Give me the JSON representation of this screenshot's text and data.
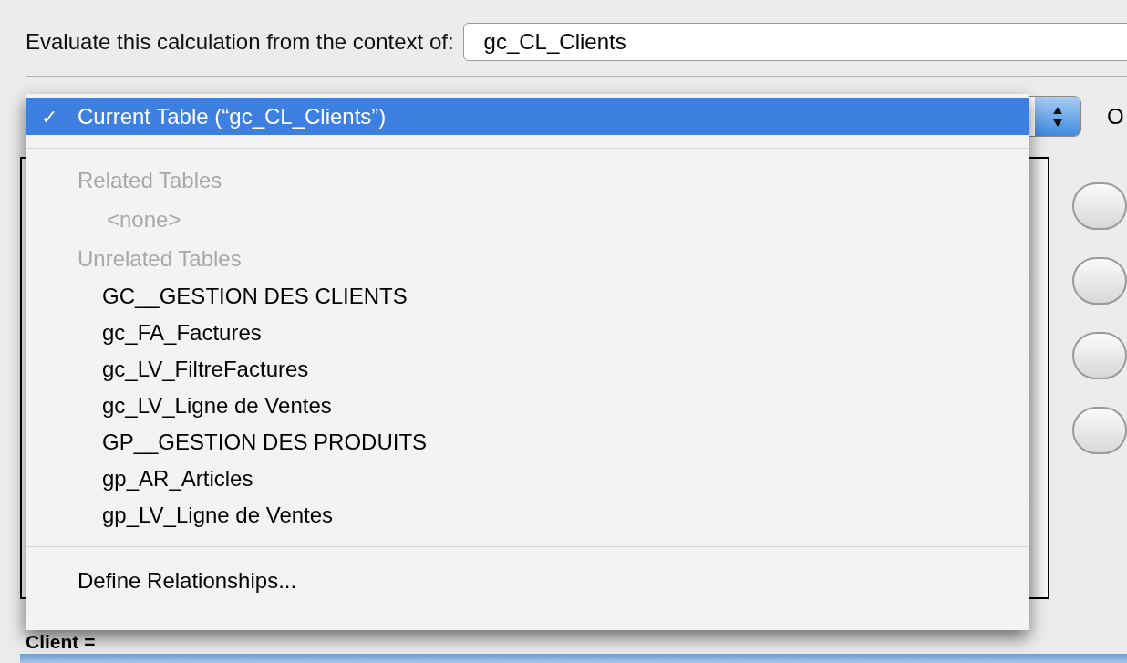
{
  "context_label": "Evaluate this calculation from the context of:",
  "context_field": {
    "value": "gc_CL_Clients"
  },
  "menu": {
    "check_glyph": "✓",
    "items": [
      {
        "kind": "item",
        "label": "Current Table (“gc_CL_Clients”)",
        "selected": true,
        "checked": true
      },
      {
        "kind": "separator"
      },
      {
        "kind": "header",
        "label": "Related Tables"
      },
      {
        "kind": "placeholder",
        "label": "<none>"
      },
      {
        "kind": "header",
        "label": "Unrelated Tables"
      },
      {
        "kind": "item",
        "label": "GC__GESTION DES CLIENTS",
        "selected": false,
        "checked": false
      },
      {
        "kind": "item",
        "label": "gc_FA_Factures",
        "selected": false,
        "checked": false
      },
      {
        "kind": "item",
        "label": "gc_LV_FiltreFactures",
        "selected": false,
        "checked": false
      },
      {
        "kind": "item",
        "label": "gc_LV_Ligne de Ventes",
        "selected": false,
        "checked": false
      },
      {
        "kind": "item",
        "label": "GP__GESTION DES PRODUITS",
        "selected": false,
        "checked": false
      },
      {
        "kind": "item",
        "label": "gp_AR_Articles",
        "selected": false,
        "checked": false
      },
      {
        "kind": "item",
        "label": "gp_LV_Ligne de Ventes",
        "selected": false,
        "checked": false
      },
      {
        "kind": "separator"
      },
      {
        "kind": "action",
        "label": "Define Relationships..."
      }
    ]
  },
  "side_label": "O",
  "formula_label": "Client ="
}
